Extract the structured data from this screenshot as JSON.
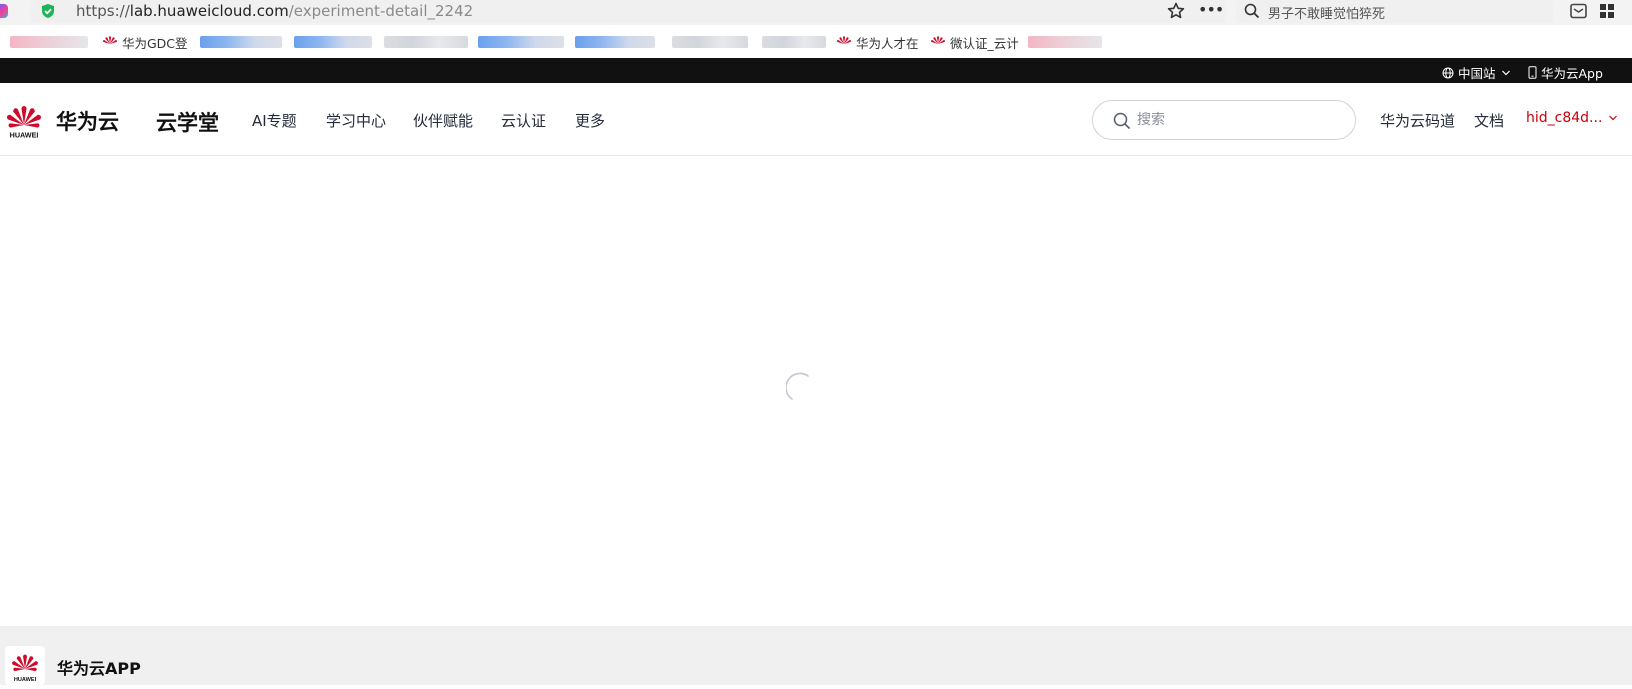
{
  "browser": {
    "url_scheme": "https://",
    "url_host": "lab.huaweicloud.com",
    "url_path": "/experiment-detail_2242",
    "search_text": "男子不敢睡觉怕猝死"
  },
  "bookmarks": [
    {
      "label": "华为GDC登"
    },
    {
      "label": "华为人才在"
    },
    {
      "label": "微认证_云计"
    }
  ],
  "topbar": {
    "region_label": "中国站",
    "app_label": "华为云App"
  },
  "header": {
    "brand": "华为云",
    "logo_text": "HUAWEI",
    "site_name": "云学堂",
    "nav": [
      {
        "label": "AI专题"
      },
      {
        "label": "学习中心"
      },
      {
        "label": "伙伴赋能"
      },
      {
        "label": "云认证"
      },
      {
        "label": "更多"
      }
    ],
    "search_placeholder": "搜索",
    "links": [
      {
        "label": "华为云码道"
      },
      {
        "label": "文档"
      }
    ],
    "user": "hid_c84d..."
  },
  "footer": {
    "logo_text": "HUAWEI",
    "title": "华为云APP"
  },
  "colors": {
    "brand_red": "#c7000b",
    "topbar_bg": "#111111",
    "footer_bg": "#f0f0f0"
  }
}
